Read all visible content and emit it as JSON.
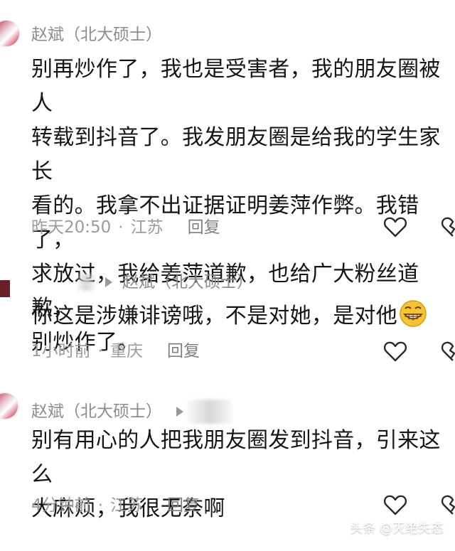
{
  "comments": [
    {
      "username": "赵斌（北大硕士）",
      "lines": [
        "别再炒作了，我也是受害者，我的朋友圈被人",
        "转载到抖音了。我发朋友圈是给我的学生家长",
        "看的。我拿不出证据证明姜萍作弊。我错了，",
        "求放过，我给姜萍道歉，也给广大粉丝道歉，",
        "别炒作了。"
      ],
      "time": "昨天20:50",
      "location": "江苏",
      "reply_label": "回复",
      "like_icon": "heart-outline-icon"
    },
    {
      "reply_to": "赵斌（北大硕士）",
      "text": "你这是涉嫌诽谤哦，不是对她，是对他",
      "emoji": "grinning-face-emoji",
      "time": "1小时前",
      "location": "重庆",
      "reply_label": "回复",
      "like_icon": "heart-outline-icon"
    },
    {
      "username": "赵斌（北大硕士）",
      "lines": [
        "别有用心的人把我朋友圈发到抖音，引来这么",
        "大麻烦，我很无奈啊"
      ],
      "time": "4分钟前",
      "location": "江苏",
      "reply_label": "回复",
      "like_icon": "heart-outline-icon"
    }
  ],
  "separator": "·",
  "watermark": "头条 @灭绝失态",
  "colors": {
    "meta_text": "#9b9b9b",
    "avatar_red": "#c72b45"
  }
}
